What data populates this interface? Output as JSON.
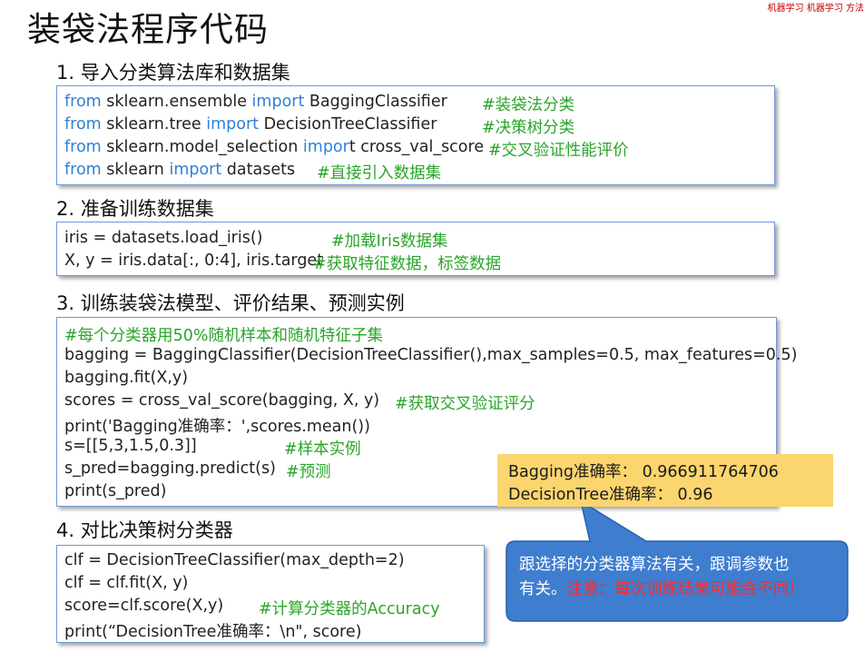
{
  "title": "装袋法程序代码",
  "top_mark": "机器学习  机器学习  方法",
  "section1": {
    "heading": "1. 导入分类算法库和数据集",
    "lines": [
      {
        "kw1": "from",
        "mod": " sklearn.ensemble ",
        "kw2": "import",
        "obj": " BaggingClassifier",
        "comment": "#装袋法分类"
      },
      {
        "kw1": "from",
        "mod": " sklearn.tree ",
        "kw2": "import",
        "obj": " DecisionTreeClassifier",
        "comment": "#决策树分类"
      },
      {
        "kw1": "from",
        "mod": " sklearn.model_selection ",
        "kw2": "impor",
        "obj": "t cross_val_score",
        "comment": "#交叉验证性能评价"
      },
      {
        "kw1": "from",
        "mod": " sklearn ",
        "kw2": "import",
        "obj": " datasets",
        "comment": "#直接引入数据集"
      }
    ]
  },
  "section2": {
    "heading": "2. 准备训练数据集",
    "lines": [
      {
        "code": "iris = datasets.load_iris()",
        "comment": "#加载Iris数据集"
      },
      {
        "code": "X, y = iris.data[:, 0:4], iris.target",
        "comment": "#获取特征数据，标签数据"
      }
    ]
  },
  "section3": {
    "heading": "3. 训练装袋法模型、评价结果、预测实例",
    "comment_line": "#每个分类器用50%随机样本和随机特征子集",
    "lines": [
      {
        "code": "bagging = BaggingClassifier(DecisionTreeClassifier(),max_samples=0.5, max_features=0.5)",
        "comment": ""
      },
      {
        "code": "bagging.fit(X,y)",
        "comment": ""
      },
      {
        "code": "scores = cross_val_score(bagging, X, y)",
        "comment": "#获取交叉验证评分"
      },
      {
        "code": "print('Bagging准确率：',scores.mean())",
        "comment": ""
      },
      {
        "code": "s=[[5,3,1.5,0.3]]",
        "comment": "#样本实例"
      },
      {
        "code": "s_pred=bagging.predict(s)",
        "comment": "#预测"
      },
      {
        "code": "print(s_pred)",
        "comment": ""
      }
    ]
  },
  "section4": {
    "heading": "4. 对比决策树分类器",
    "lines": [
      {
        "code": "clf = DecisionTreeClassifier(max_depth=2)",
        "comment": ""
      },
      {
        "code": "clf = clf.fit(X, y)",
        "comment": ""
      },
      {
        "code": "score=clf.score(X,y)",
        "comment": "#计算分类器的Accuracy"
      },
      {
        "code": "print(“DecisionTree准确率：\\n\", score)",
        "comment": ""
      }
    ]
  },
  "result_box": {
    "line1": "Bagging准确率：  0.966911764706",
    "line2": "DecisionTree准确率：  0.96"
  },
  "note_bubble": {
    "line1": "跟选择的分类器算法有关，跟调参数也",
    "line2_prefix": "有关。",
    "line2_warning": "注意：每次训练结果可能会不同!"
  },
  "colors": {
    "keyword": "#2f80d8",
    "comment": "#2aa52a",
    "box_border": "#6b9bd8",
    "result_bg": "#fbd56e",
    "bubble_bg": "#3f7dcf",
    "warning": "#ff2a2a"
  }
}
